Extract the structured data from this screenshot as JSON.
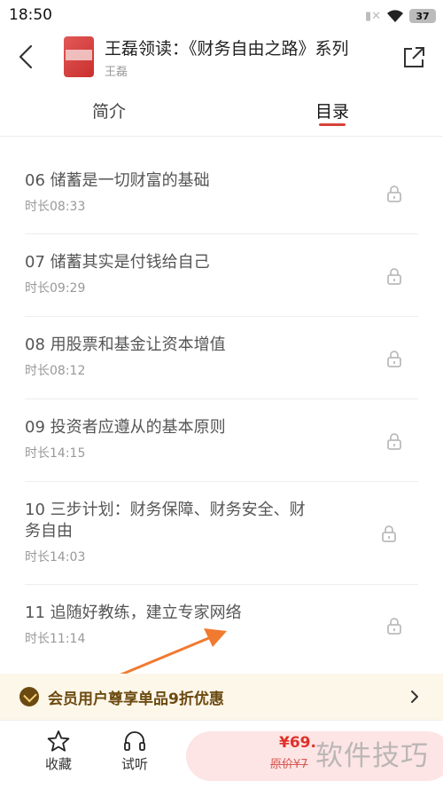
{
  "status_bar": {
    "time": "18:50",
    "battery": "37"
  },
  "header": {
    "title": "王磊领读：《财务自由之路》系列",
    "author": "王磊",
    "back_icon": "back-chevron-icon",
    "share_icon": "share-icon"
  },
  "tabs": {
    "intro": "简介",
    "catalog": "目录",
    "active": "catalog",
    "accent_color": "#d7423a"
  },
  "chapters": [
    {
      "title": "06 储蓄是一切财富的基础",
      "duration": "时长08:33",
      "locked": true
    },
    {
      "title": "07 储蓄其实是付钱给自己",
      "duration": "时长09:29",
      "locked": true
    },
    {
      "title": "08 用股票和基金让资本增值",
      "duration": "时长08:12",
      "locked": true
    },
    {
      "title": "09 投资者应遵从的基本原则",
      "duration": "时长14:15",
      "locked": true
    },
    {
      "title": "10 三步计划：财务保障、财务安全、财务自由",
      "duration": "时长14:03",
      "locked": true
    },
    {
      "title": "11 追随好教练，建立专家网络",
      "duration": "时长11:14",
      "locked": true
    }
  ],
  "promo": {
    "text": "会员用户尊享单品9折优惠",
    "color": "#6b4a10"
  },
  "bottom_bar": {
    "favorite_label": "收藏",
    "trial_label": "试听",
    "price": "¥69.",
    "original_price": "原价¥7"
  },
  "watermark": "软件技巧",
  "annotation_arrow_color": "#f07a30"
}
